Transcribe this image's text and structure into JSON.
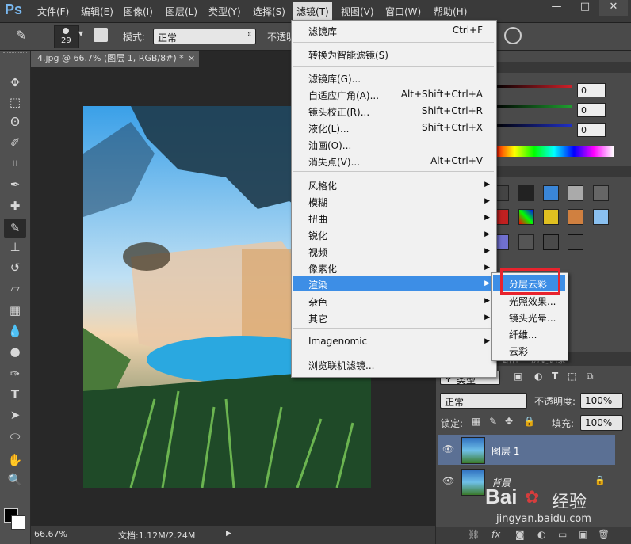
{
  "menubar": {
    "logo": "Ps",
    "items": [
      "文件(F)",
      "编辑(E)",
      "图像(I)",
      "图层(L)",
      "类型(Y)",
      "选择(S)",
      "滤镜(T)",
      "视图(V)",
      "窗口(W)",
      "帮助(H)"
    ],
    "active_index": 6,
    "window_controls": [
      "—",
      "□",
      "✕"
    ]
  },
  "options": {
    "brush_size": "29",
    "mode_label": "模式:",
    "mode_value": "正常",
    "opacity_label": "不透明"
  },
  "document": {
    "tab_title": "4.jpg @ 66.7% (图层 1, RGB/8#) *",
    "tab_close": "×"
  },
  "status": {
    "zoom": "66.67%",
    "doc_info": "文档:1.12M/2.24M"
  },
  "filter_menu": {
    "items": [
      {
        "label": "滤镜库",
        "shortcut": "Ctrl+F"
      },
      {
        "label": "转换为智能滤镜(S)",
        "shortcut": ""
      },
      {
        "label": "滤镜库(G)...",
        "shortcut": ""
      },
      {
        "label": "自适应广角(A)...",
        "shortcut": "Alt+Shift+Ctrl+A"
      },
      {
        "label": "镜头校正(R)...",
        "shortcut": "Shift+Ctrl+R"
      },
      {
        "label": "液化(L)...",
        "shortcut": "Shift+Ctrl+X"
      },
      {
        "label": "油画(O)...",
        "shortcut": ""
      },
      {
        "label": "消失点(V)...",
        "shortcut": "Alt+Ctrl+V"
      },
      {
        "label": "风格化",
        "shortcut": ""
      },
      {
        "label": "模糊",
        "shortcut": ""
      },
      {
        "label": "扭曲",
        "shortcut": ""
      },
      {
        "label": "锐化",
        "shortcut": ""
      },
      {
        "label": "视频",
        "shortcut": ""
      },
      {
        "label": "像素化",
        "shortcut": ""
      },
      {
        "label": "渲染",
        "shortcut": ""
      },
      {
        "label": "杂色",
        "shortcut": ""
      },
      {
        "label": "其它",
        "shortcut": ""
      },
      {
        "label": "Imagenomic",
        "shortcut": ""
      },
      {
        "label": "浏览联机滤镜...",
        "shortcut": ""
      }
    ],
    "highlighted": "渲染"
  },
  "render_submenu": {
    "items": [
      "分层云彩",
      "光照效果...",
      "镜头光晕...",
      "纤维...",
      "云彩"
    ],
    "highlighted": "分层云彩"
  },
  "color_panel": {
    "values": [
      "0",
      "0",
      "0"
    ],
    "colors": {
      "r": "#d0202a",
      "g": "#1fa030",
      "b": "#2030c8"
    }
  },
  "layers_panel": {
    "tabs": [
      "路径",
      "历史记录"
    ],
    "kind_filter": "类型",
    "blend_mode": "正常",
    "opacity_label": "不透明度:",
    "opacity_value": "100%",
    "lock_label": "锁定:",
    "fill_label": "填充:",
    "fill_value": "100%",
    "layers": [
      {
        "name": "图层 1",
        "selected": true,
        "locked": false
      },
      {
        "name": "背景",
        "selected": false,
        "locked": true
      }
    ]
  },
  "watermark": {
    "brand": "Bai",
    "suffix": "经验",
    "url": "jingyan.baidu.com"
  }
}
